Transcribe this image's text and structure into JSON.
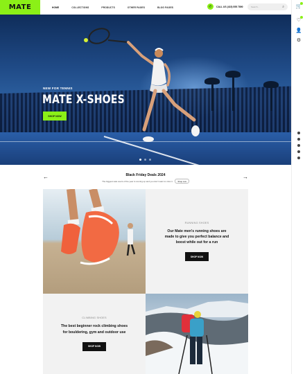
{
  "brand": {
    "logo": "MATE",
    "accent": "#8bf017"
  },
  "nav": {
    "items": [
      "HOME",
      "COLLECTIONS",
      "PRODUCTS",
      "OTHER PAGES",
      "BLOG PAGES"
    ]
  },
  "header": {
    "call": "CALL US (415) 555 7890",
    "search_placeholder": "Search..."
  },
  "hero": {
    "eyebrow": "NEW FOR TENNIS",
    "title": "MATE X-SHOES",
    "button": "SHOP NOW",
    "slides": 3,
    "active_slide": 1
  },
  "promo": {
    "title": "Black Friday Deals 2024",
    "text": "The biggest sale event of the year is coming up and you don't want to miss it.",
    "link": "Shop now"
  },
  "tiles": {
    "running": {
      "eyebrow": "RUNNING SHOES",
      "body": [
        "Our Mate men's running shoes are",
        "made to give you perfect balance and",
        "boost while out for a run"
      ],
      "button": "SHOP NOW"
    },
    "climbing": {
      "eyebrow": "CLIMBING SHOES",
      "body": [
        "The best beginner rock climbing shoes",
        "for bouldering, gym and outdoor use"
      ],
      "button": "SHOP NOW"
    }
  },
  "rail": {
    "icons": [
      "cart-icon",
      "heart-icon",
      "user-icon",
      "settings-icon"
    ],
    "social": [
      "instagram-icon",
      "facebook-icon",
      "twitter-icon",
      "youtube-icon",
      "pinterest-icon"
    ]
  }
}
